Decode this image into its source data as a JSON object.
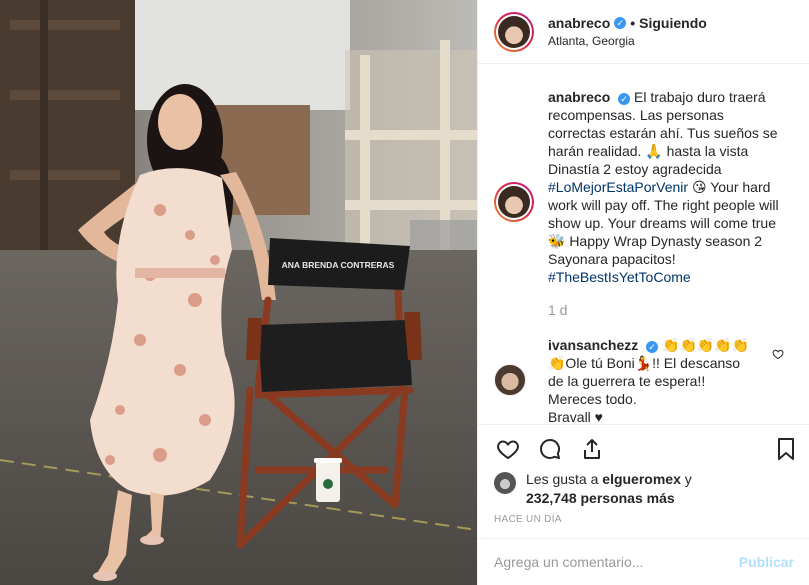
{
  "header": {
    "username": "anabreco",
    "separator": "•",
    "follow_status": "Siguiendo",
    "location": "Atlanta, Georgia"
  },
  "photo": {
    "chair_label": "ANA BRENDA CONTRERAS"
  },
  "caption": {
    "author": "anabreco",
    "text_es": "El trabajo duro traerá recompensas. Las personas correctas estarán ahí. Tus sueños se harán realidad. 🙏 hasta la vista Dinastía 2 estoy agradecida",
    "hashtag_es": "#LoMejorEstaPorVenir",
    "text_en_1": "😘 Your hard work will pay off. The right people will show up. Your dreams will come true",
    "text_en_2": "🐝 Happy Wrap Dynasty season 2 Sayonara papacitos!",
    "hashtag_en": "#TheBestIsYetToCome"
  },
  "time_ago": "1 d",
  "comment": {
    "author": "ivansanchezz",
    "text": "👏👏👏👏👏 👏Ole tú Boni💃!! El descanso de la guerrera te espera!! Mereces todo.",
    "text_more": "Bravall ♥"
  },
  "likes": {
    "prefix": "Les gusta a",
    "liker": "elgueromex",
    "connector": "y",
    "count": "232,748",
    "suffix": "personas más"
  },
  "posted_date": "HACE UN DÍA",
  "add_comment": {
    "placeholder": "Agrega un comentario...",
    "publish_label": "Publicar"
  },
  "colors": {
    "verified": "#3897f0",
    "hashtag": "#003569",
    "muted": "#999999",
    "publish_disabled": "#b2dffc"
  }
}
